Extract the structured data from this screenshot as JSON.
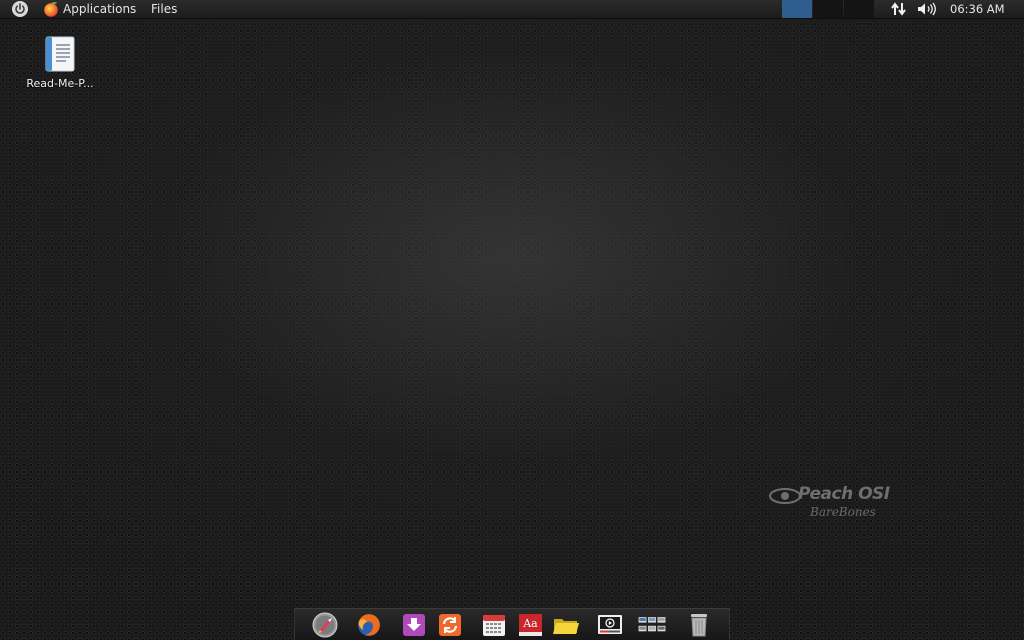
{
  "top_panel": {
    "applications_label": "Applications",
    "files_label": "Files",
    "clock": "06:36 AM",
    "workspaces": 3,
    "active_workspace": 1,
    "active_workspace_color": "#2f5d8e"
  },
  "desktop": {
    "icons": [
      {
        "label": "Read-Me-P...",
        "icon": "document-icon"
      }
    ]
  },
  "watermark": {
    "title": "Peach OSI",
    "subtitle": "BareBones"
  },
  "dock": {
    "items": [
      {
        "name": "launcher-rocket-icon"
      },
      {
        "name": "firefox-icon"
      },
      {
        "name": "download-icon"
      },
      {
        "name": "update-icon"
      },
      {
        "name": "calendar-icon"
      },
      {
        "name": "dictionary-icon"
      },
      {
        "name": "folder-icon"
      },
      {
        "name": "media-player-icon"
      },
      {
        "name": "workspace-switcher-icon"
      },
      {
        "name": "trash-icon"
      }
    ]
  }
}
